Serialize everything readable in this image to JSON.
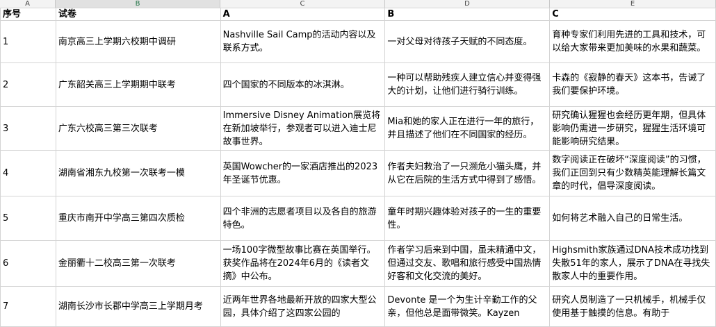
{
  "column_letters": [
    "A",
    "B",
    "C",
    "D",
    "E"
  ],
  "header": {
    "seq": "序号",
    "paper": "试卷",
    "a": "A",
    "b": "B",
    "c": "C"
  },
  "rows": [
    {
      "seq": "1",
      "paper": "南京高三上学期六校期中调研",
      "a": "Nashville Sail Camp的活动内容以及联系方式。",
      "b": "一对父母对待孩子天赋的不同态度。",
      "c": "育种专家们利用先进的工具和技术，可以给大家带来更加美味的水果和蔬菜。"
    },
    {
      "seq": "2",
      "paper": "广东韶关高三上学期期中联考",
      "a": "四个国家的不同版本的冰淇淋。",
      "b": "一种可以帮助残疾人建立信心并变得强大的计划，让他们进行骑行训练。",
      "c": "卡森的《寂静的春天》这本书，告诫了我们要保护环境。"
    },
    {
      "seq": "3",
      "paper": "广东六校高三第三次联考",
      "a": "Immersive Disney Animation展览将在新加坡举行，参观者可以进入迪士尼故事世界。",
      "b": "Mia和她的家人正在进行一年的旅行，并且描述了他们在不同国家的经历。",
      "c": "研究确认猩猩也会经历更年期，但具体影响仍需进一步研究，猩猩生活环境可能影响研究结果。"
    },
    {
      "seq": "4",
      "paper": "湖南省湘东九校第一次联考一模",
      "a": "英国Wowcher的一家酒店推出的2023年圣诞节优惠。",
      "b": "作者夫妇救治了一只濒危小猫头鹰，并从它在后院的生活方式中得到了感悟。",
      "c": "数字阅读正在破坏“深度阅读”的习惯，我们正回到只有少数精英能理解长篇文章的时代，倡导深度阅读。"
    },
    {
      "seq": "5",
      "paper": "重庆市南开中学高三第四次质检",
      "a": "四个非洲的志愿者项目以及各自的旅游特色。",
      "b": "童年时期兴趣体验对孩子的一生的重要性。",
      "c": "如何将艺术融入自己的日常生活。"
    },
    {
      "seq": "6",
      "paper": "金丽衢十二校高三第一次联考",
      "a": "一场100字微型故事比赛在英国举行。获奖作品将在2024年6月的《读者文摘》中公布。",
      "b": "作者学习后来到中国，虽未精通中文，但通过交友、歌唱和旅行感受中国热情好客和文化交流的美好。",
      "c": "Highsmith家族通过DNA技术成功找到失散51年的家人，展示了DNA在寻找失散家人中的重要作用。"
    },
    {
      "seq": "7",
      "paper": "湖南长沙市长郡中学高三上学期月考",
      "a": "近两年世界各地最新开放的四家大型公园，具体介绍了这四家公园的",
      "b": "Devonte 是一个为生计辛勤工作的父亲，但他总是面带微笑。Kayzen",
      "c": "研究人员制造了一只机械手，机械手仅使用基于触摸的信息。有助于"
    }
  ]
}
